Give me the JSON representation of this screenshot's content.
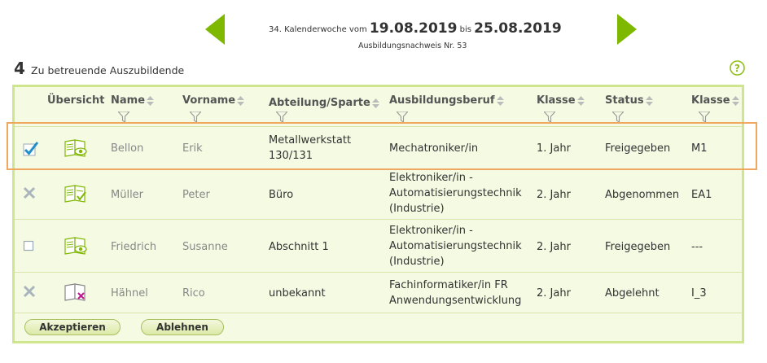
{
  "week": {
    "number_prefix": "34. Kalenderwoche vom",
    "start_date": "19.08.2019",
    "between": "bis",
    "end_date": "25.08.2019",
    "report": "Ausbildungsnachweis Nr. 53"
  },
  "count": {
    "value": "4",
    "label": "Zu betreuende Auszubildende"
  },
  "colors": {
    "accent": "#7fb800",
    "box_border": "#cfe58e",
    "box_bg": "#f5fae3",
    "highlight": "#f0a860"
  },
  "columns": {
    "overview": "Übersicht",
    "name": "Name",
    "vorname": "Vorname",
    "abteilung": "Abteilung/Sparte",
    "beruf": "Ausbildungsberuf",
    "klasse1": "Klasse",
    "status": "Status",
    "klasse2": "Klasse"
  },
  "rows": [
    {
      "selection": "checked",
      "overview_icon": "book-eye-icon",
      "name": "Bellon",
      "vorname": "Erik",
      "abteilung_1": "Metallwerkstatt",
      "abteilung_2": "130/131",
      "beruf_1": "Mechatroniker/in",
      "beruf_2": "",
      "beruf_3": "",
      "jahr": "1. Jahr",
      "status": "Freigegeben",
      "klasse": "M1"
    },
    {
      "selection": "disabled",
      "overview_icon": "book-check-icon",
      "name": "Müller",
      "vorname": "Peter",
      "abteilung_1": "Büro",
      "abteilung_2": "",
      "beruf_1": "Elektroniker/in -",
      "beruf_2": "Automatisierungstechnik",
      "beruf_3": "(Industrie)",
      "jahr": "2. Jahr",
      "status": "Abgenommen",
      "klasse": "EA1"
    },
    {
      "selection": "unchecked",
      "overview_icon": "book-eye-icon",
      "name": "Friedrich",
      "vorname": "Susanne",
      "abteilung_1": "Abschnitt 1",
      "abteilung_2": "",
      "beruf_1": "Elektroniker/in -",
      "beruf_2": "Automatisierungstechnik",
      "beruf_3": "(Industrie)",
      "jahr": "2. Jahr",
      "status": "Freigegeben",
      "klasse": "---"
    },
    {
      "selection": "disabled",
      "overview_icon": "book-rejected-icon",
      "name": "Hähnel",
      "vorname": "Rico",
      "abteilung_1": "unbekannt",
      "abteilung_2": "",
      "beruf_1": "Fachinformatiker/in FR",
      "beruf_2": "Anwendungsentwicklung",
      "beruf_3": "",
      "jahr": "2. Jahr",
      "status": "Abgelehnt",
      "klasse": "I_3"
    }
  ],
  "buttons": {
    "accept": "Akzeptieren",
    "reject": "Ablehnen"
  }
}
